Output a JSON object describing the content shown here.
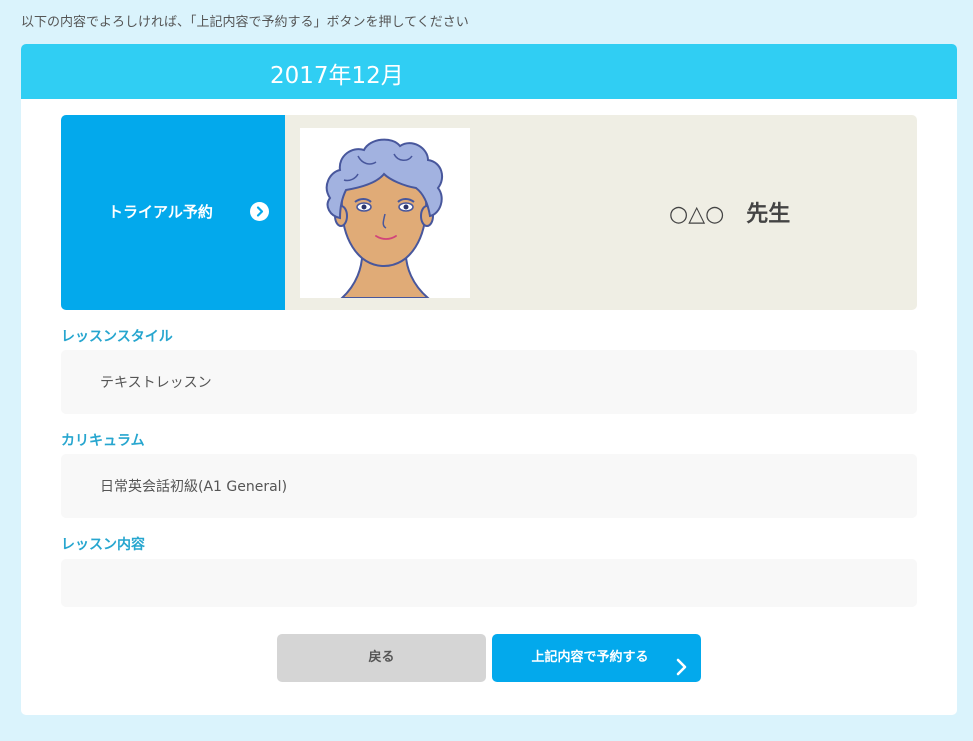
{
  "instruction": "以下の内容でよろしければ、「上記内容で予約する」ボタンを押してください",
  "header": {
    "month": "2017年12月"
  },
  "teacher_card": {
    "trial_label": "トライアル予約",
    "teacher_name": "○△○　先生"
  },
  "fields": {
    "lesson_style_label": "レッスンスタイル",
    "lesson_style_value": "テキストレッスン",
    "curriculum_label": "カリキュラム",
    "curriculum_value": "日常英会話初級(A1 General)",
    "lesson_content_label": "レッスン内容",
    "lesson_content_value": ""
  },
  "buttons": {
    "back_label": "戻る",
    "submit_label": "上記内容で予約する"
  },
  "colors": {
    "page_background": "#daf3fc",
    "header_background": "#30cef3",
    "accent_blue": "#03a9ec",
    "label_blue": "#27a6cf",
    "card_background": "#efeee4",
    "field_background": "#f8f8f8",
    "back_button": "#d5d5d5"
  },
  "icons": {
    "trial_arrow": "chevron-right-circle-icon",
    "submit_arrow": "chevron-right-icon",
    "teacher_avatar": "teacher-avatar-illustration"
  }
}
